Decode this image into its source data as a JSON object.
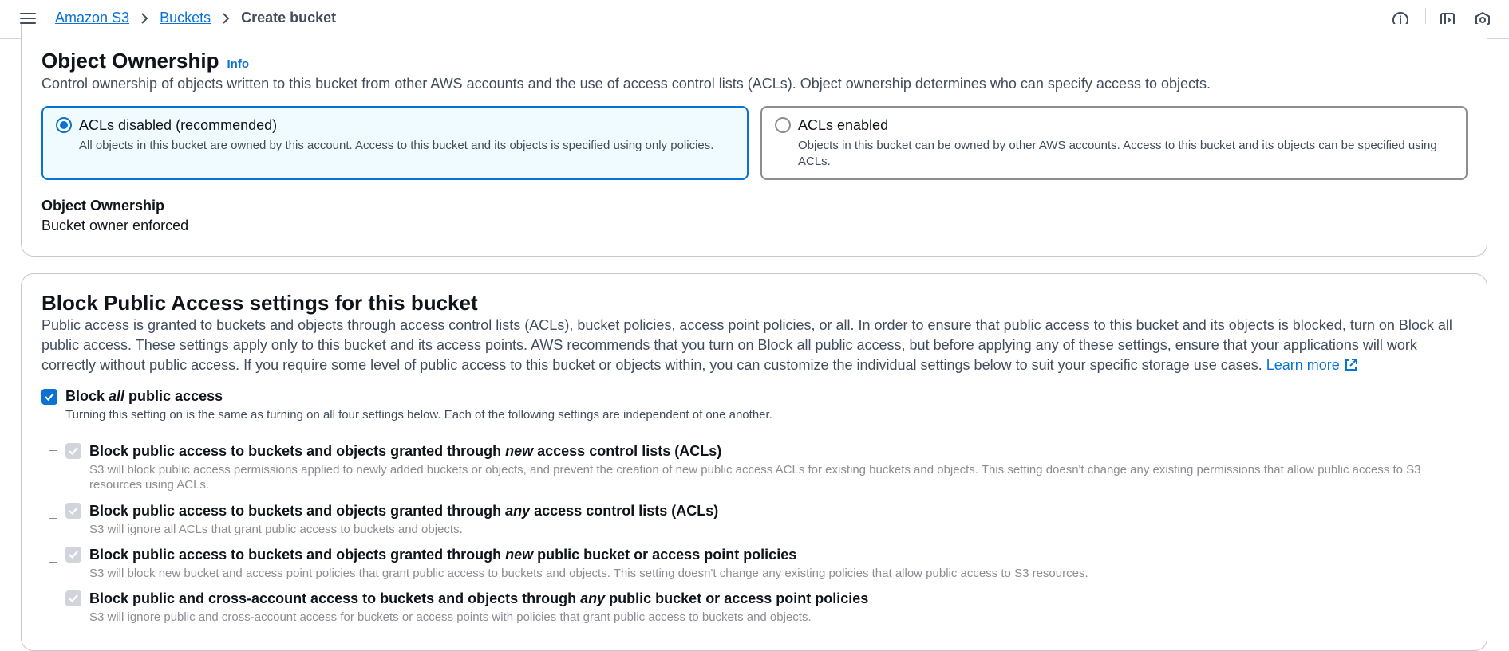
{
  "header": {
    "breadcrumbs": [
      "Amazon S3",
      "Buckets"
    ],
    "current": "Create bucket"
  },
  "ownership": {
    "title": "Object Ownership",
    "info": "Info",
    "description": "Control ownership of objects written to this bucket from other AWS accounts and the use of access control lists (ACLs). Object ownership determines who can specify access to objects.",
    "options": [
      {
        "label": "ACLs disabled (recommended)",
        "description": "All objects in this bucket are owned by this account. Access to this bucket and its objects is specified using only policies.",
        "selected": true
      },
      {
        "label": "ACLs enabled",
        "description": "Objects in this bucket can be owned by other AWS accounts. Access to this bucket and its objects can be specified using ACLs.",
        "selected": false
      }
    ],
    "field_label": "Object Ownership",
    "field_value": "Bucket owner enforced"
  },
  "block_public": {
    "title": "Block Public Access settings for this bucket",
    "description": "Public access is granted to buckets and objects through access control lists (ACLs), bucket policies, access point policies, or all. In order to ensure that public access to this bucket and its objects is blocked, turn on Block all public access. These settings apply only to this bucket and its access points. AWS recommends that you turn on Block all public access, but before applying any of these settings, ensure that your applications will work correctly without public access. If you require some level of public access to this bucket or objects within, you can customize the individual settings below to suit your specific storage use cases.",
    "learn_more": "Learn more",
    "all": {
      "pre": "Block ",
      "em": "all",
      "post": " public access",
      "description": "Turning this setting on is the same as turning on all four settings below. Each of the following settings are independent of one another.",
      "checked": true
    },
    "options": [
      {
        "pre": "Block public access to buckets and objects granted through ",
        "em": "new",
        "post": " access control lists (ACLs)",
        "description": "S3 will block public access permissions applied to newly added buckets or objects, and prevent the creation of new public access ACLs for existing buckets and objects. This setting doesn't change any existing permissions that allow public access to S3 resources using ACLs."
      },
      {
        "pre": "Block public access to buckets and objects granted through ",
        "em": "any",
        "post": " access control lists (ACLs)",
        "description": "S3 will ignore all ACLs that grant public access to buckets and objects."
      },
      {
        "pre": "Block public access to buckets and objects granted through ",
        "em": "new",
        "post": " public bucket or access point policies",
        "description": "S3 will block new bucket and access point policies that grant public access to buckets and objects. This setting doesn't change any existing policies that allow public access to S3 resources."
      },
      {
        "pre": "Block public and cross-account access to buckets and objects through ",
        "em": "any",
        "post": " public bucket or access point policies",
        "description": "S3 will ignore public and cross-account access for buckets or access points with policies that grant public access to buckets and objects."
      }
    ]
  },
  "icons": {
    "menu": "hamburger-menu-icon",
    "info": "info-circle-icon",
    "notifications": "notification-panel-icon",
    "settings": "settings-hex-icon",
    "external": "external-link-icon",
    "check": "check-icon"
  },
  "colors": {
    "accent": "#0972d3",
    "selected_bg": "#f0fbff",
    "disabled": "#d1d5db"
  }
}
